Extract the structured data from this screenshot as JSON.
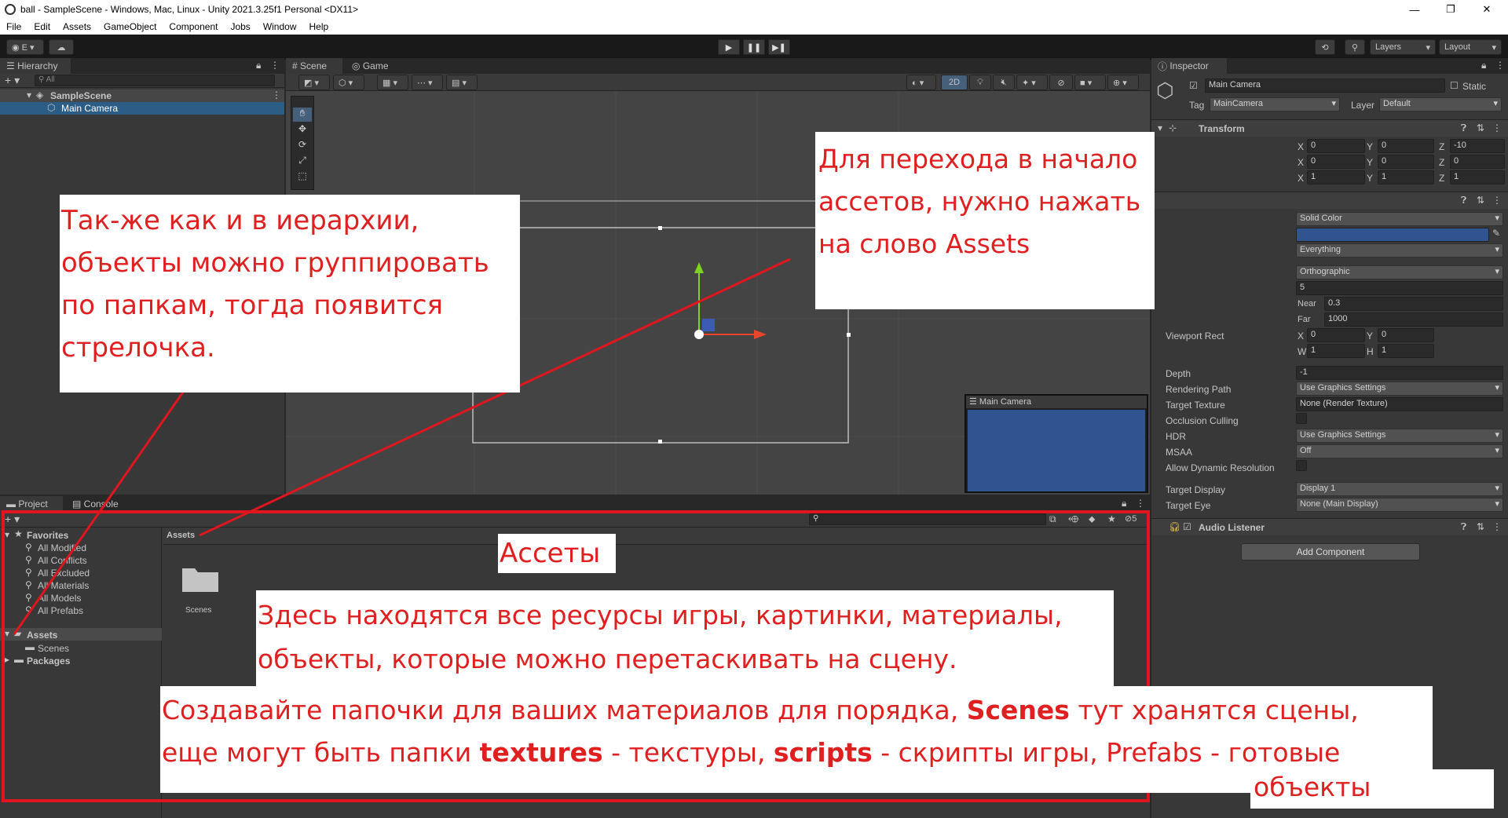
{
  "window": {
    "title": "ball - SampleScene - Windows, Mac, Linux - Unity 2021.3.25f1 Personal <DX11>",
    "controls": [
      "—",
      "❐",
      "✕"
    ]
  },
  "menu": [
    "File",
    "Edit",
    "Assets",
    "GameObject",
    "Component",
    "Jobs",
    "Window",
    "Help"
  ],
  "toolbar": {
    "account_label": "E ▾",
    "layers_label": "Layers",
    "layout_label": "Layout"
  },
  "hierarchy": {
    "tab": "Hierarchy",
    "search_placeholder": "All",
    "scene": "SampleScene",
    "items": [
      "Main Camera"
    ]
  },
  "scene_view": {
    "tabs": [
      "Scene",
      "Game"
    ],
    "mode_2d": "2D",
    "camera_preview_title": "Main Camera"
  },
  "inspector": {
    "tab": "Inspector",
    "object_name": "Main Camera",
    "static_label": "Static",
    "tag_label": "Tag",
    "tag_value": "MainCamera",
    "layer_label": "Layer",
    "layer_value": "Default",
    "transform": {
      "title": "Transform",
      "position": [
        "0",
        "0",
        "-10"
      ],
      "rotation": [
        "0",
        "0",
        "0"
      ],
      "scale": [
        "1",
        "1",
        "1"
      ]
    },
    "camera": {
      "clear_flags": "Solid Color",
      "culling_mask": "Everything",
      "projection": "Orthographic",
      "size": "5",
      "near_label": "Near",
      "near": "0.3",
      "far_label": "Far",
      "far": "1000",
      "viewport_label": "Viewport Rect",
      "viewport": {
        "x": "0",
        "y": "0",
        "w": "1",
        "h": "1"
      },
      "depth_label": "Depth",
      "depth": "-1",
      "rendering_path_label": "Rendering Path",
      "rendering_path": "Use Graphics Settings",
      "target_texture_label": "Target Texture",
      "target_texture": "None (Render Texture)",
      "occlusion_label": "Occlusion Culling",
      "hdr_label": "HDR",
      "hdr": "Use Graphics Settings",
      "msaa_label": "MSAA",
      "msaa": "Off",
      "dynres_label": "Allow Dynamic Resolution",
      "target_display_label": "Target Display",
      "target_display": "Display 1",
      "target_eye_label": "Target Eye",
      "target_eye": "None (Main Display)"
    },
    "audio_listener": "Audio Listener",
    "add_component": "Add Component"
  },
  "project": {
    "tabs": [
      "Project",
      "Console"
    ],
    "favorites_label": "Favorites",
    "favorites": [
      "All Modified",
      "All Conflicts",
      "All Excluded",
      "All Materials",
      "All Models",
      "All Prefabs"
    ],
    "assets_label": "Assets",
    "scenes_label": "Scenes",
    "packages_label": "Packages",
    "breadcrumb": "Assets",
    "folder_name": "Scenes",
    "badge_count": "5"
  },
  "annotations": {
    "assets_heading": "Для перехода в начало ассетов, нужно нажать на слово Assets",
    "grouping": "Так-же как и в иерархии, объекты можно группировать по папкам, тогда появится стрелочка.",
    "assets_title": "Ассеты",
    "resources": "Здесь находятся все ресурсы игры, картинки, материалы, объекты, которые можно перетаскивать на сцену.",
    "folders_part1": "Создавайте папочки для ваших материалов для порядка, ",
    "folders_scenes": "Scenes",
    "folders_part2": " тут хранятся сцены,",
    "folders_part3": "еще могут быть папки ",
    "folders_textures": "textures",
    "folders_part4": " - текстуры, ",
    "folders_scripts": "scripts",
    "folders_part5": " - скрипты игры, Prefabs - ",
    "folders_ready": "готовые",
    "folders_objects": "объекты"
  }
}
